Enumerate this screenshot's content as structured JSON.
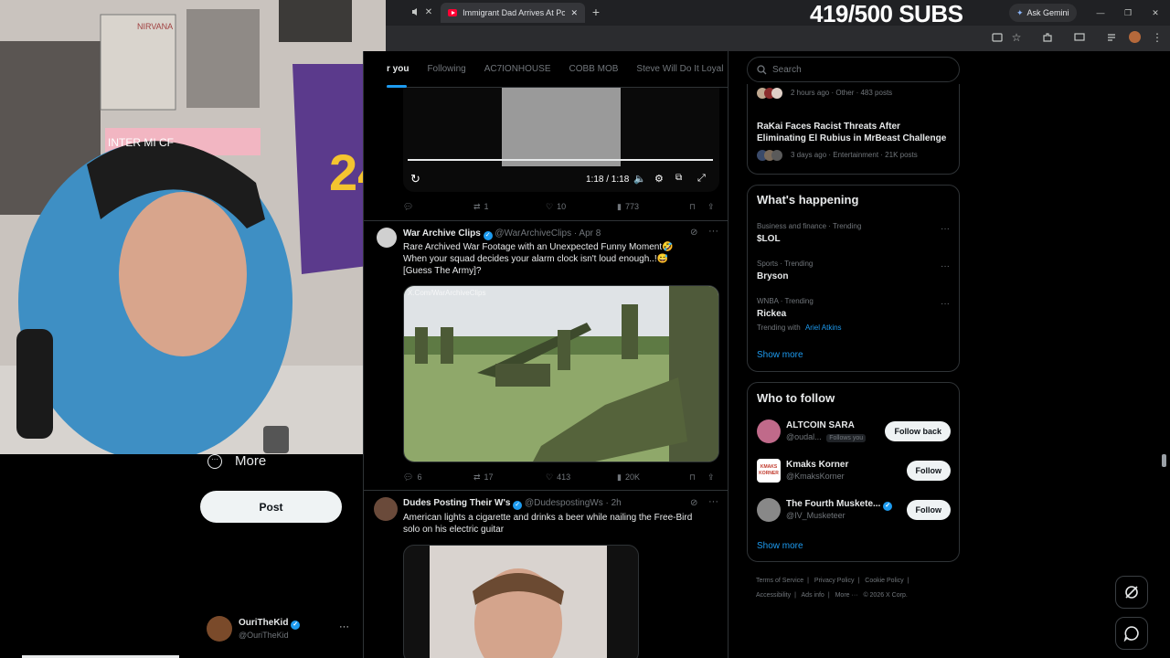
{
  "browser": {
    "tab_title": "Immigrant Dad Arrives At Polic",
    "new_tab": "+",
    "gemini_label": "Ask Gemini",
    "window_controls": [
      "—",
      "❐",
      "✕"
    ]
  },
  "overlay": {
    "subs_text": "419/500 SUBS"
  },
  "webcam": {
    "jersey_number": "24",
    "banner_text": "INTER  MI  CF",
    "poster_text": "NIRVANA"
  },
  "nav": {
    "more_label": "More",
    "post_label": "Post",
    "profile": {
      "name": "OuriTheKid",
      "handle": "@OuriTheKid"
    }
  },
  "feed": {
    "tabs": [
      "r you",
      "Following",
      "AC7IONHOUSE",
      "COBB MOB",
      "Steve Will Do It Loyal"
    ],
    "video": {
      "time": "1:18 / 1:18"
    },
    "tweet0_actions": {
      "replies": "",
      "reposts": "1",
      "likes": "10",
      "views": "773"
    },
    "tweet1": {
      "name": "War Archive Clips",
      "handle": "@WarArchiveClips",
      "time": "· Apr 8",
      "text_line1": "Rare Archived War Footage with an Unexpected Funny Moment🤣",
      "text_line2": "When your squad decides your alarm clock isn't loud enough..!😅",
      "text_line3": "[Guess The Army]?",
      "watermark": "X.Com/WarArchiveClips",
      "replies": "6",
      "reposts": "17",
      "likes": "413",
      "views": "20K"
    },
    "tweet2": {
      "name": "Dudes Posting Their W's",
      "handle": "@DudespostingWs",
      "time": "· 2h",
      "text_line1": "American lights a cigarette and drinks a beer while nailing the Free-Bird",
      "text_line2": "solo on his electric guitar"
    }
  },
  "sidebar": {
    "search_placeholder": "Search",
    "news": [
      {
        "meta": "2 hours ago · Other · 483 posts"
      },
      {
        "title_line1": "RaKai Faces Racist Threats After",
        "title_line2": "Eliminating El Rubius in MrBeast Challenge",
        "meta": "3 days ago · Entertainment · 21K posts"
      }
    ],
    "happening": {
      "title": "What's happening",
      "trends": [
        {
          "category": "Business and finance · Trending",
          "name": "$LOL"
        },
        {
          "category": "Sports · Trending",
          "name": "Bryson"
        },
        {
          "category": "WNBA · Trending",
          "name": "Rickea",
          "extra_prefix": "Trending with",
          "extra_link": "Ariel Atkins"
        }
      ],
      "show_more": "Show more"
    },
    "who_to_follow": {
      "title": "Who to follow",
      "accounts": [
        {
          "name": "ALTCOIN SARA",
          "handle": "@oudal...",
          "badge": "Follows you",
          "button": "Follow back"
        },
        {
          "name": "Kmaks Korner",
          "handle": "@KmaksKorner",
          "avatar_text": "KMAKS KORNER",
          "button": "Follow"
        },
        {
          "name": "The Fourth Muskete...",
          "handle": "@IV_Musketeer",
          "button": "Follow"
        }
      ],
      "show_more": "Show more"
    },
    "footer": [
      "Terms of Service",
      "|",
      "Privacy Policy",
      "|",
      "Cookie Policy",
      "|",
      "Accessibility",
      "|",
      "Ads info",
      "|",
      "More ···",
      "© 2026 X Corp."
    ]
  },
  "colors": {
    "accent": "#1d9bf0",
    "background": "#000000",
    "border": "#2f3336",
    "muted": "#71767b"
  }
}
